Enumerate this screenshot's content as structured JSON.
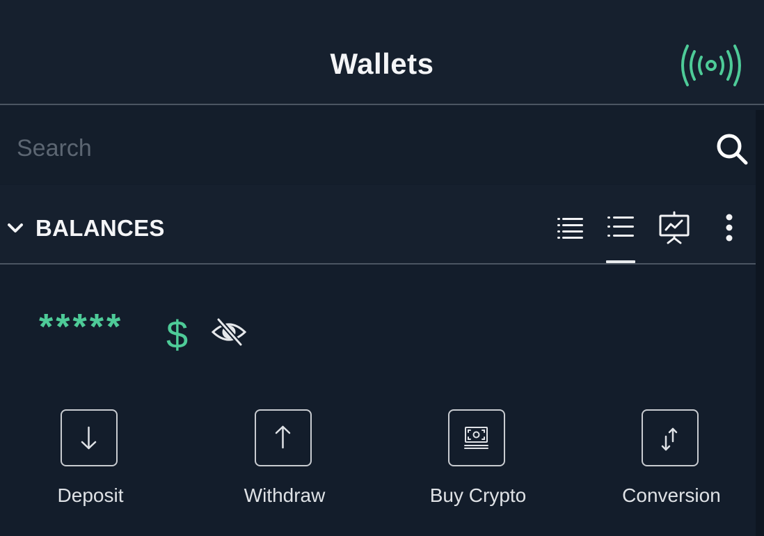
{
  "header": {
    "title": "Wallets",
    "broadcast_icon": "broadcast-signal-icon",
    "accent_color": "#4ecb98"
  },
  "search": {
    "value": "",
    "placeholder": "Search",
    "icon": "search-icon"
  },
  "balances": {
    "section_label": "BALANCES",
    "collapse_icon": "chevron-down-icon",
    "view_options": [
      {
        "name": "compact-list-view",
        "icon": "dense-list-icon",
        "active": false
      },
      {
        "name": "list-view",
        "icon": "list-icon",
        "active": true
      },
      {
        "name": "chart-view",
        "icon": "presentation-chart-icon",
        "active": false
      }
    ],
    "more_icon": "more-vertical-icon",
    "amount_masked": "*****",
    "currency_symbol": "$",
    "visibility_icon": "eye-off-icon"
  },
  "actions": [
    {
      "label": "Deposit",
      "icon": "arrow-down-icon"
    },
    {
      "label": "Withdraw",
      "icon": "arrow-up-icon"
    },
    {
      "label": "Buy Crypto",
      "icon": "cash-icon"
    },
    {
      "label": "Conversion",
      "icon": "swap-vertical-icon"
    }
  ]
}
